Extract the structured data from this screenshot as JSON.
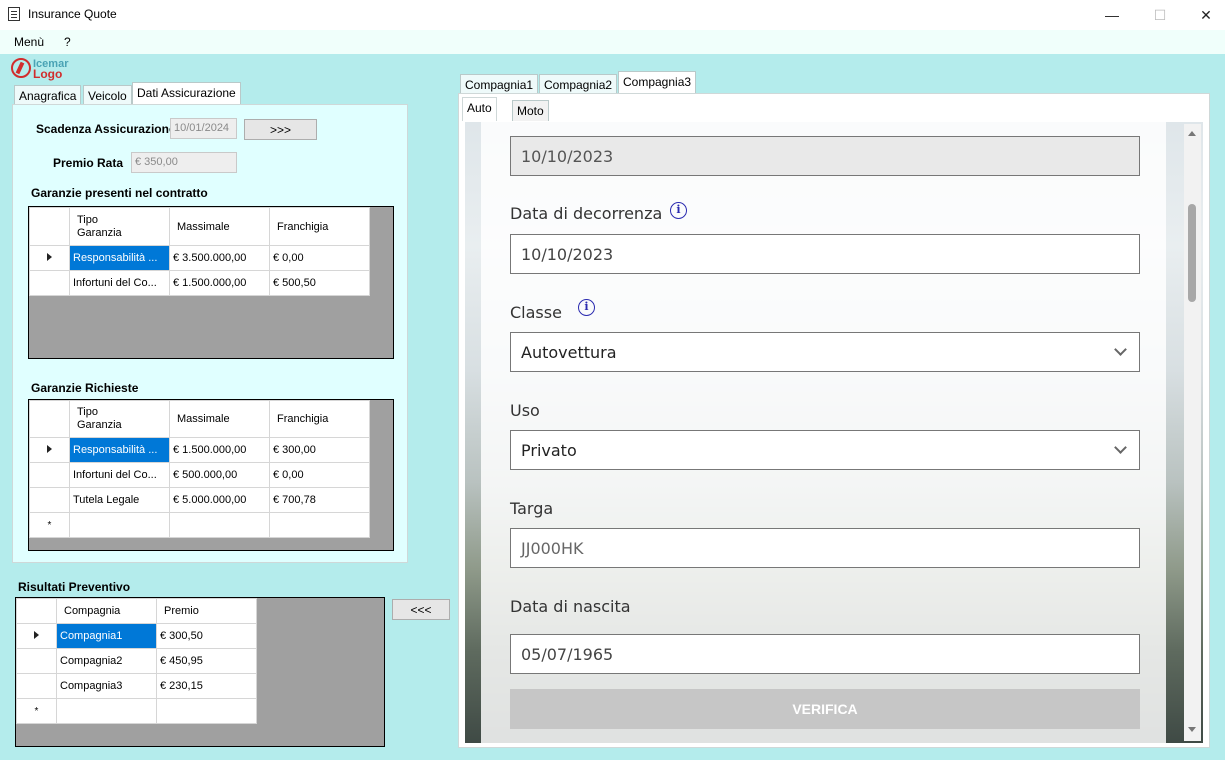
{
  "window": {
    "title": "Insurance Quote",
    "minimize": "—",
    "maximize": "☐",
    "close": "✕"
  },
  "menu": {
    "items": [
      "Menù",
      "?"
    ]
  },
  "logo": {
    "top": "Icemar",
    "bottom": "Logo"
  },
  "left_tabs": [
    "Anagrafica",
    "Veicolo",
    "Dati Assicurazione"
  ],
  "dati": {
    "scadenza_label": "Scadenza Assicurazione",
    "scadenza_value": "10/01/2024",
    "next_button": ">>>",
    "premio_label": "Premio Rata",
    "premio_value": "€ 350,00",
    "garanzie_presenti_title": "Garanzie presenti nel contratto",
    "garanzie_richieste_title": "Garanzie Richieste",
    "col_tipo_1": "Tipo",
    "col_tipo_2": "Garanzia",
    "col_massimale": "Massimale",
    "col_franchigia": "Franchigia",
    "presenti_rows": [
      [
        "Responsabilità ...",
        "€ 3.500.000,00",
        "€ 0,00"
      ],
      [
        "Infortuni del Co...",
        "€ 1.500.000,00",
        "€ 500,50"
      ]
    ],
    "richieste_rows": [
      [
        "Responsabilità ...",
        "€ 1.500.000,00",
        "€ 300,00"
      ],
      [
        "Infortuni del Co...",
        "€ 500.000,00",
        "€ 0,00"
      ],
      [
        "Tutela Legale",
        "€ 5.000.000,00",
        "€ 700,78"
      ]
    ],
    "new_row_marker": "*"
  },
  "risultati": {
    "title": "Risultati Preventivo",
    "col_compagnia": "Compagnia",
    "col_premio": "Premio",
    "rows": [
      [
        "Compagnia1",
        "€ 300,50"
      ],
      [
        "Compagnia2",
        "€ 450,95"
      ],
      [
        "Compagnia3",
        "€ 230,15"
      ]
    ],
    "back_button": "<<<"
  },
  "company_tabs": [
    "Compagnia1",
    "Compagnia2",
    "Compagnia3"
  ],
  "vehicle_tabs": [
    "Auto",
    "Moto"
  ],
  "form": {
    "first_value": "10/10/2023",
    "decorrenza_label": "Data di decorrenza",
    "decorrenza_value": "10/10/2023",
    "classe_label": "Classe",
    "classe_value": "Autovettura",
    "uso_label": "Uso",
    "uso_value": "Privato",
    "targa_label": "Targa",
    "targa_value": "JJ000HK",
    "nascita_label": "Data di nascita",
    "nascita_value": "05/07/1965",
    "verifica_button": "VERIFICA",
    "info_glyph": "i"
  },
  "colors": {
    "background": "#b4ecec",
    "tabpage": "#e0ffff",
    "selection": "#0078d7",
    "logo_red": "#d12d2d",
    "info_blue": "#2b2bb0"
  }
}
